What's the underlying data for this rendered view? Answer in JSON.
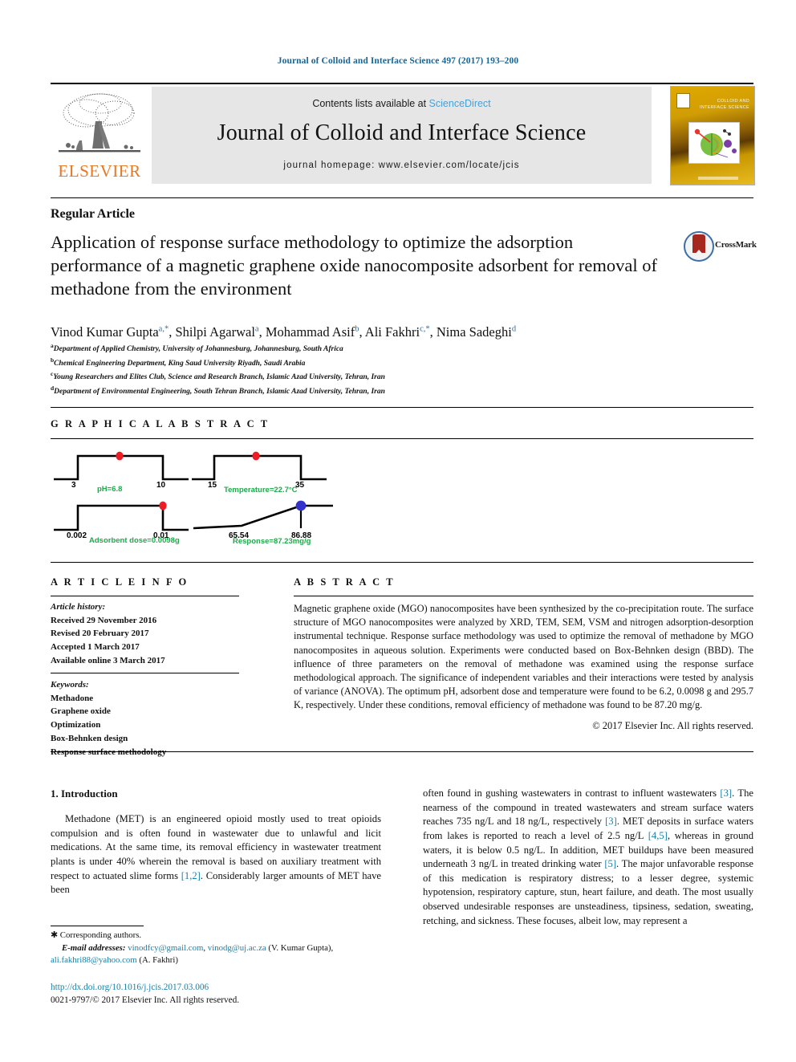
{
  "header": {
    "journal_ref": "Journal of Colloid and Interface Science 497 (2017) 193–200",
    "contents_prefix": "Contents lists available at ",
    "sciencedirect": "ScienceDirect",
    "journal_title": "Journal of Colloid and Interface Science",
    "homepage": "journal homepage: www.elsevier.com/locate/jcis",
    "publisher": "ELSEVIER",
    "cover_title": "COLLOID AND INTERFACE SCIENCE"
  },
  "article": {
    "type": "Regular Article",
    "title": "Application of response surface methodology to optimize the adsorption performance of a magnetic graphene oxide nanocomposite adsorbent for removal of methadone from the environment",
    "crossmark_label": "CrossMark",
    "authors": [
      {
        "name": "Vinod Kumar Gupta",
        "marks": "a,*"
      },
      {
        "name": "Shilpi Agarwal",
        "marks": "a"
      },
      {
        "name": "Mohammad Asif",
        "marks": "b"
      },
      {
        "name": "Ali Fakhri",
        "marks": "c,*"
      },
      {
        "name": "Nima Sadeghi",
        "marks": "d"
      }
    ],
    "affiliations": [
      {
        "mark": "a",
        "text": "Department of Applied Chemistry, University of Johannesburg, Johannesburg, South Africa"
      },
      {
        "mark": "b",
        "text": "Chemical Engineering Department, King Saud University Riyadh, Saudi Arabia"
      },
      {
        "mark": "c",
        "text": "Young Researchers and Elites Club, Science and Research Branch, Islamic Azad University, Tehran, Iran"
      },
      {
        "mark": "d",
        "text": "Department of Environmental Engineering, South Tehran Branch, Islamic Azad University, Tehran, Iran"
      }
    ]
  },
  "graphical_abstract": {
    "heading": "G R A P H I C A L   A B S T R A C T",
    "panels": [
      {
        "id": "ph",
        "low_label": "3",
        "high_label": "10",
        "caption": "pH=6.8",
        "marker": "red",
        "marker_pos": "center"
      },
      {
        "id": "temperature",
        "low_label": "15",
        "high_label": "35",
        "caption": "Temperature=22.7°C",
        "marker": "red",
        "marker_pos": "center"
      },
      {
        "id": "dose",
        "low_label": "0.002",
        "high_label": "0.01",
        "caption": "Adsorbent dose=0.0098g",
        "marker": "red",
        "marker_pos": "right"
      },
      {
        "id": "response",
        "low_label": "65.54",
        "high_label": "86.88",
        "caption": "Response=87.23mg/g",
        "marker": "blue",
        "marker_pos": "right"
      }
    ],
    "caption_color": "#1faa4b",
    "marker_red": "#ee1c25",
    "marker_blue": "#3333cc"
  },
  "article_info": {
    "heading": "A R T I C L E   I N F O",
    "history_label": "Article history:",
    "history": [
      "Received 29 November 2016",
      "Revised 20 February 2017",
      "Accepted 1 March 2017",
      "Available online 3 March 2017"
    ],
    "keywords_label": "Keywords:",
    "keywords": [
      "Methadone",
      "Graphene oxide",
      "Optimization",
      "Box-Behnken design",
      "Response surface methodology"
    ]
  },
  "abstract": {
    "heading": "A B S T R A C T",
    "text": "Magnetic graphene oxide (MGO) nanocomposites have been synthesized by the co-precipitation route. The surface structure of MGO nanocomposites were analyzed by XRD, TEM, SEM, VSM and nitrogen adsorption-desorption instrumental technique. Response surface methodology was used to optimize the removal of methadone by MGO nanocomposites in aqueous solution. Experiments were conducted based on Box-Behnken design (BBD). The influence of three parameters on the removal of methadone was examined using the response surface methodological approach. The significance of independent variables and their interactions were tested by analysis of variance (ANOVA). The optimum pH, adsorbent dose and temperature were found to be 6.2, 0.0098 g and 295.7 K, respectively. Under these conditions, removal efficiency of methadone was found to be 87.20 mg/g.",
    "copyright": "© 2017 Elsevier Inc. All rights reserved."
  },
  "body": {
    "section_title": "1. Introduction",
    "left_paragraph_part1": "Methadone (MET) is an engineered opioid mostly used to treat opioids compulsion and is often found in wastewater due to unlawful and licit medications. At the same time, its removal efficiency in wastewater treatment plants is under 40% wherein the removal is based on auxiliary treatment with respect to actuated slime forms ",
    "left_ref1": "[1,2]",
    "left_paragraph_part2": ". Considerably larger amounts of MET have been",
    "right_segments": [
      {
        "text": "often found in gushing wastewaters in contrast to influent wastewaters "
      },
      {
        "ref": "[3]"
      },
      {
        "text": ". The nearness of the compound in treated wastewaters and stream surface waters reaches 735 ng/L and 18 ng/L, respectively "
      },
      {
        "ref": "[3]"
      },
      {
        "text": ". MET deposits in surface waters from lakes is reported to reach a level of 2.5 ng/L "
      },
      {
        "ref": "[4,5]"
      },
      {
        "text": ", whereas in ground waters, it is below 0.5 ng/L. In addition, MET buildups have been measured underneath 3 ng/L in treated drinking water "
      },
      {
        "ref": "[5]"
      },
      {
        "text": ". The major unfavorable response of this medication is respiratory distress; to a lesser degree, systemic hypotension, respiratory capture, stun, heart failure, and death. The most usually observed undesirable responses are unsteadiness, tipsiness, sedation, sweating, retching, and sickness. These focuses, albeit low, may represent a"
      }
    ]
  },
  "footer": {
    "corresponding_mark": "✱",
    "corresponding_text": "Corresponding authors.",
    "email_label": "E-mail addresses:",
    "email_1": "vinodfcy@gmail.com",
    "email_2": "vinodg@uj.ac.za",
    "email_1_owner": "(V. Kumar Gupta)",
    "email_3": "ali.fakhri88@yahoo.com",
    "email_3_owner": "(A. Fakhri)",
    "doi": "http://dx.doi.org/10.1016/j.jcis.2017.03.006",
    "issn_line": "0021-9797/© 2017 Elsevier Inc. All rights reserved."
  }
}
